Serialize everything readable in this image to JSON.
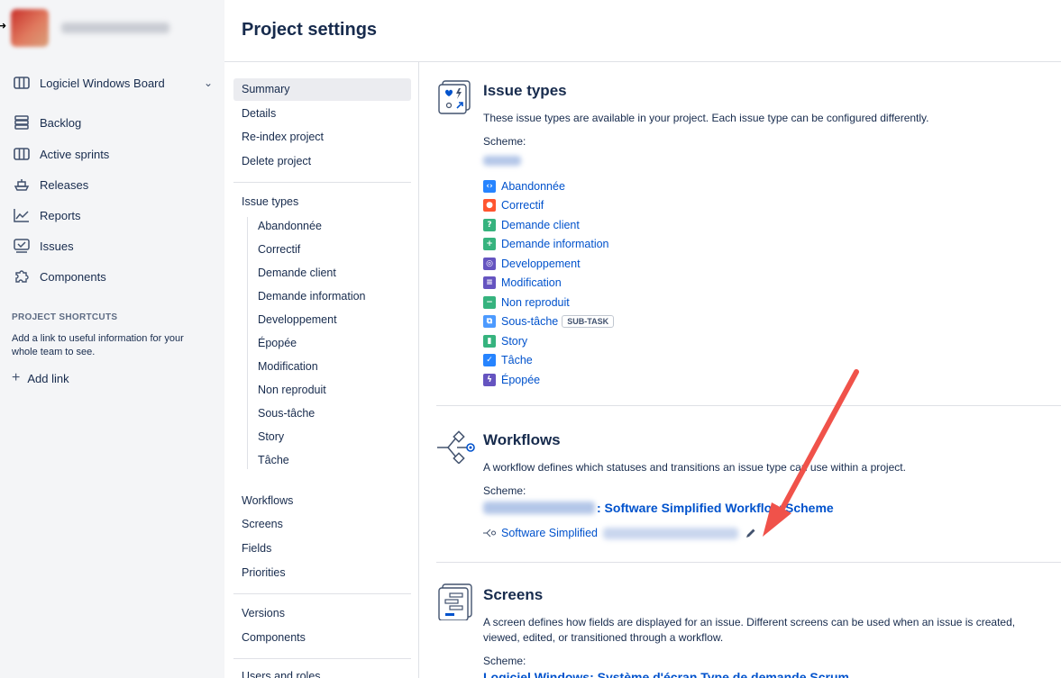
{
  "nav": {
    "board": {
      "label": "Logiciel Windows Board",
      "icon": "board-icon"
    },
    "items": [
      {
        "label": "Backlog",
        "icon": "backlog-icon"
      },
      {
        "label": "Active sprints",
        "icon": "board-icon"
      },
      {
        "label": "Releases",
        "icon": "ship-icon"
      },
      {
        "label": "Reports",
        "icon": "chart-icon"
      },
      {
        "label": "Issues",
        "icon": "issues-icon"
      },
      {
        "label": "Components",
        "icon": "puzzle-icon"
      }
    ],
    "shortcuts_heading": "PROJECT SHORTCUTS",
    "shortcuts_text": "Add a link to useful information for your whole team to see.",
    "add_link": "Add link"
  },
  "header": {
    "title": "Project settings"
  },
  "settings_menu": {
    "top": [
      "Summary",
      "Details",
      "Re-index project",
      "Delete project"
    ],
    "issue_types_heading": "Issue types",
    "issue_types": [
      "Abandonnée",
      "Correctif",
      "Demande client",
      "Demande information",
      "Developpement",
      "Épopée",
      "Modification",
      "Non reproduit",
      "Sous-tâche",
      "Story",
      "Tâche"
    ],
    "group2": [
      "Workflows",
      "Screens",
      "Fields",
      "Priorities"
    ],
    "group3": [
      "Versions",
      "Components"
    ],
    "cut_off": "Users and roles"
  },
  "issue_types": {
    "title": "Issue types",
    "desc": "These issue types are available in your project. Each issue type can be configured differently.",
    "scheme_label": "Scheme:",
    "items": [
      {
        "name": "Abandonnée",
        "color": "#2684ff",
        "glyph": "‹›"
      },
      {
        "name": "Correctif",
        "color": "#ff5630",
        "glyph": "●"
      },
      {
        "name": "Demande client",
        "color": "#36b37e",
        "glyph": "?"
      },
      {
        "name": "Demande information",
        "color": "#36b37e",
        "glyph": "+"
      },
      {
        "name": "Developpement",
        "color": "#6554c0",
        "glyph": "◎"
      },
      {
        "name": "Modification",
        "color": "#6554c0",
        "glyph": "≡"
      },
      {
        "name": "Non reproduit",
        "color": "#36b37e",
        "glyph": "−"
      },
      {
        "name": "Sous-tâche",
        "color": "#4c9aff",
        "glyph": "⧉",
        "lozenge": "SUB-TASK"
      },
      {
        "name": "Story",
        "color": "#36b37e",
        "glyph": "▮"
      },
      {
        "name": "Tâche",
        "color": "#2684ff",
        "glyph": "✓"
      },
      {
        "name": "Épopée",
        "color": "#6554c0",
        "glyph": "ϟ"
      }
    ]
  },
  "workflows": {
    "title": "Workflows",
    "desc": "A workflow defines which statuses and transitions an issue type can use within a project.",
    "scheme_label": "Scheme:",
    "scheme_link_suffix": ": Software Simplified Workflow Scheme",
    "item_label": "Software Simplified"
  },
  "screens": {
    "title": "Screens",
    "desc": "A screen defines how fields are displayed for an issue. Different screens can be used when an issue is created, viewed, edited, or transitioned through a workflow.",
    "scheme_label": "Scheme:",
    "scheme_link": "Logiciel Windows: Système d'écran Type de demande Scrum"
  },
  "colors": {
    "link": "#0052cc",
    "arrow": "#f0524a",
    "nav_bg": "#f4f5f7"
  }
}
